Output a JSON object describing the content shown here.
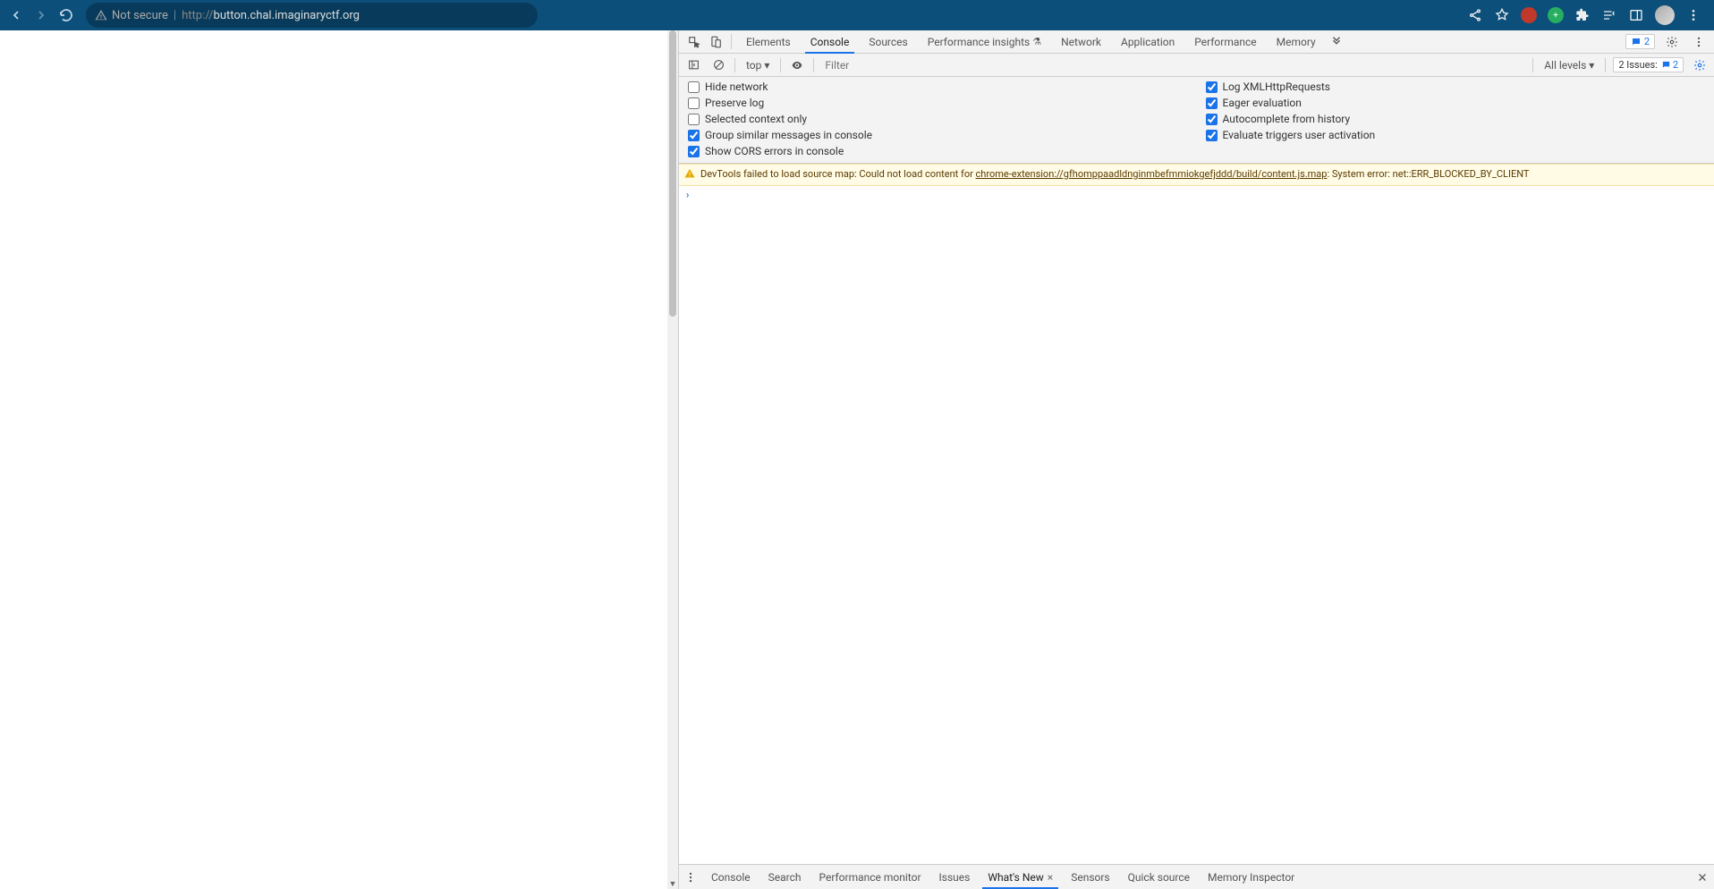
{
  "browser": {
    "not_secure": "Not secure",
    "url_prefix": "http://",
    "url_host": "button.chal.imaginaryctf.org"
  },
  "devtools": {
    "tabs": {
      "elements": "Elements",
      "console": "Console",
      "sources": "Sources",
      "perf_insights": "Performance insights",
      "network": "Network",
      "application": "Application",
      "performance": "Performance",
      "memory": "Memory"
    },
    "top_badge_count": "2",
    "console_toolbar": {
      "context": "top",
      "filter_placeholder": "Filter",
      "levels": "All levels",
      "issues_label": "2 Issues:",
      "issues_count": "2"
    },
    "settings": {
      "hide_network": "Hide network",
      "log_xhr": "Log XMLHttpRequests",
      "preserve_log": "Preserve log",
      "eager_eval": "Eager evaluation",
      "selected_ctx": "Selected context only",
      "autocomplete_hist": "Autocomplete from history",
      "group_similar": "Group similar messages in console",
      "eval_triggers": "Evaluate triggers user activation",
      "show_cors": "Show CORS errors in console"
    },
    "warning": {
      "prefix": "DevTools failed to load source map: Could not load content for ",
      "link": "chrome-extension://gfhomppaadldnginmbefmmiokgefjddd/build/content.js.map",
      "suffix": ": System error: net::ERR_BLOCKED_BY_CLIENT"
    },
    "drawer": {
      "console": "Console",
      "search": "Search",
      "perf_monitor": "Performance monitor",
      "issues": "Issues",
      "whats_new": "What's New",
      "sensors": "Sensors",
      "quick_source": "Quick source",
      "mem_inspector": "Memory Inspector"
    }
  }
}
